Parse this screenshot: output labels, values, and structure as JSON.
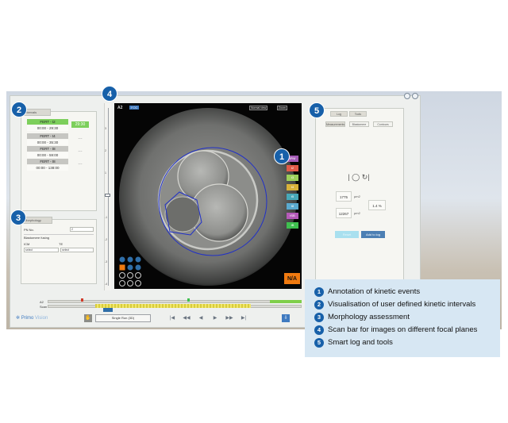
{
  "left_panel": {
    "intervals_tab": "Intervals",
    "intervals": [
      {
        "label": "FERT - t2",
        "time": "00:00 - 29:30",
        "duration": "29:30",
        "label_color": "#7dcf5c",
        "duration_color": "#7dcf5c"
      },
      {
        "label": "FERT - t4",
        "time": "00:00 - 35:30",
        "duration": "---",
        "label_color": "#b8b8b4",
        "duration_color": "#b8b8b4"
      },
      {
        "label": "FERT - t8",
        "time": "00:00 - 59:00",
        "duration": "---",
        "label_color": "#b8b8b4",
        "duration_color": "#b8b8b4"
      },
      {
        "label": "FERT - t8",
        "time": "00:00 - 138:00",
        "duration": "---",
        "label_color": "#b8b8b4",
        "duration_color": "#b8b8b4"
      }
    ],
    "morphology_tab": "Morphology",
    "pn_label": "PN No.",
    "pn_value": "2",
    "blastomere_label": "Blastomere fusing",
    "icm_label": "ICM",
    "te_label": "TE",
    "select_a": "select",
    "select_b": "select"
  },
  "scan": {
    "ticks": [
      "3",
      "2",
      "1",
      "0",
      "-1",
      "-2",
      "-3",
      "-4"
    ]
  },
  "viewer": {
    "well_label": "A2",
    "tag": "FOC",
    "top_select_1": "Normal view",
    "top_select_2": "Zoom",
    "na_label": "N/A",
    "events": [
      {
        "label": "tPNf",
        "color": "#a45ab5"
      },
      {
        "label": "t2",
        "color": "#e05a48"
      },
      {
        "label": "t3",
        "color": "#9ccf5a"
      },
      {
        "label": "t4",
        "color": "#d8b23a"
      },
      {
        "label": "t5",
        "color": "#47a8b8"
      },
      {
        "label": "t8",
        "color": "#5aa9cf"
      },
      {
        "label": "tSB",
        "color": "#b55ab8"
      },
      {
        "label": "tB",
        "color": "#3fbf4f"
      }
    ]
  },
  "right_panel": {
    "tab_1": "Log",
    "tab_2": "Tools",
    "sub_tab_1": "Measurements",
    "sub_tab_2": "Blastomere",
    "sub_tab_3": "Contours",
    "area_value": "1775",
    "area_unit": "µm2",
    "percent_value": "1.4 %",
    "area2_value": "12267",
    "area2_unit": "µm2",
    "btn_disabled": "Reset",
    "btn_add": "Add to log"
  },
  "timeline": {
    "row1_label": "A2",
    "row2_label": "Scan"
  },
  "bottom_bar": {
    "brand": "Primo",
    "brand_suffix": "Vision",
    "view_label": "Single Run (3D)",
    "controls": [
      "|◀",
      "◀◀",
      "◀",
      "▶",
      "▶▶",
      "▶|"
    ]
  },
  "legend": [
    {
      "num": "1",
      "text": "Annotation of kinetic events"
    },
    {
      "num": "2",
      "text": "Visualisation of user defined kinetic intervals"
    },
    {
      "num": "3",
      "text": "Morphology assessment"
    },
    {
      "num": "4",
      "text": "Scan bar for images on different focal planes"
    },
    {
      "num": "5",
      "text": "Smart log and tools"
    }
  ],
  "callouts": [
    "1",
    "2",
    "3",
    "4",
    "5"
  ],
  "colors": {
    "callout_blue": "#1760a9",
    "legend_bg": "#d7e7f3",
    "na_orange": "#f07a10",
    "add_button": "#4c7fb4"
  }
}
